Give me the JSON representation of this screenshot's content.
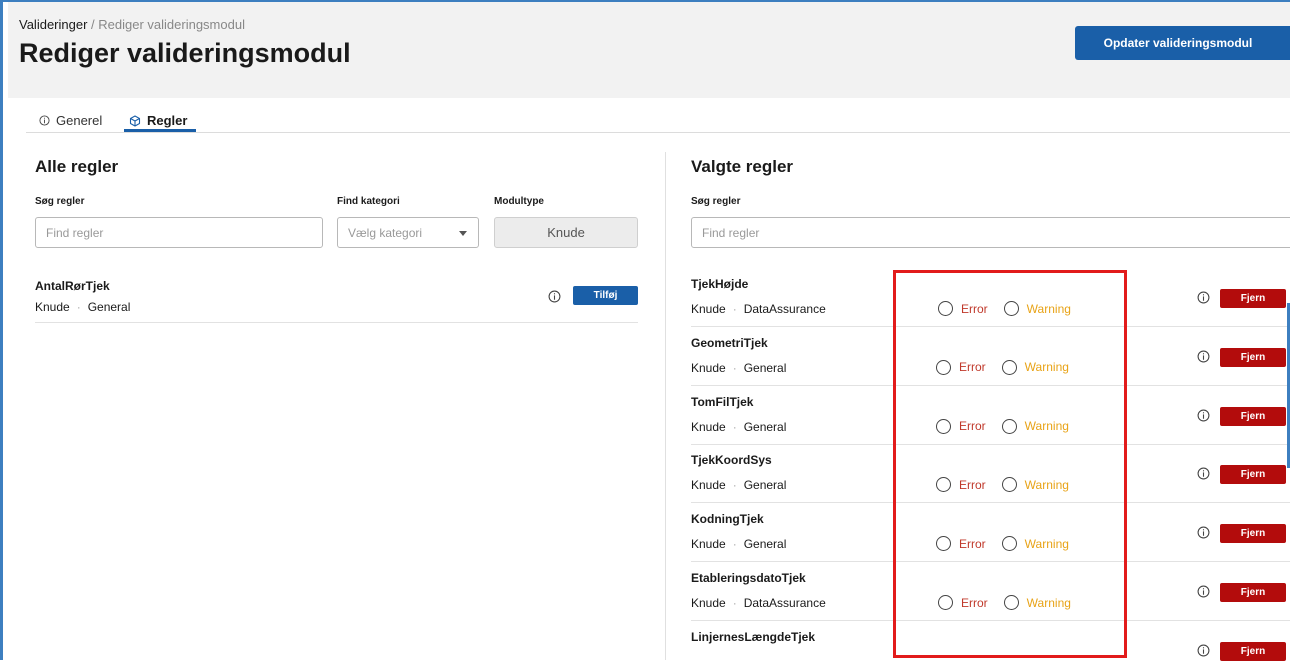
{
  "breadcrumb": {
    "parent": "Valideringer",
    "separator": " / ",
    "current": "Rediger valideringsmodul"
  },
  "page_title": "Rediger valideringsmodul",
  "update_button": "Opdater valideringsmodul",
  "tabs": [
    {
      "label": "Generel",
      "icon": "info-icon",
      "active": false
    },
    {
      "label": "Regler",
      "icon": "cube-icon",
      "active": true
    }
  ],
  "all_rules": {
    "title": "Alle regler",
    "search_label": "Søg regler",
    "search_placeholder": "Find regler",
    "category_label": "Find kategori",
    "category_placeholder": "Vælg kategori",
    "moduletype_label": "Modultype",
    "moduletype_value": "Knude",
    "items": [
      {
        "name": "AntalRørTjek",
        "type": "Knude",
        "category": "General",
        "action": "Tilføj"
      }
    ]
  },
  "selected_rules": {
    "title": "Valgte regler",
    "search_label": "Søg regler",
    "search_placeholder": "Find regler",
    "error_label": "Error",
    "warning_label": "Warning",
    "remove_label": "Fjern",
    "items": [
      {
        "name": "TjekHøjde",
        "type": "Knude",
        "category": "DataAssurance"
      },
      {
        "name": "GeometriTjek",
        "type": "Knude",
        "category": "General"
      },
      {
        "name": "TomFilTjek",
        "type": "Knude",
        "category": "General"
      },
      {
        "name": "TjekKoordSys",
        "type": "Knude",
        "category": "General"
      },
      {
        "name": "KodningTjek",
        "type": "Knude",
        "category": "General"
      },
      {
        "name": "EtableringsdatoTjek",
        "type": "Knude",
        "category": "DataAssurance"
      },
      {
        "name": "LinjernesLængdeTjek",
        "type": "",
        "category": ""
      }
    ]
  },
  "colors": {
    "primary": "#1a5fa8",
    "danger": "#b30c0c",
    "error": "#c0392b",
    "warning": "#e8a317",
    "highlight": "#e21b1b"
  }
}
